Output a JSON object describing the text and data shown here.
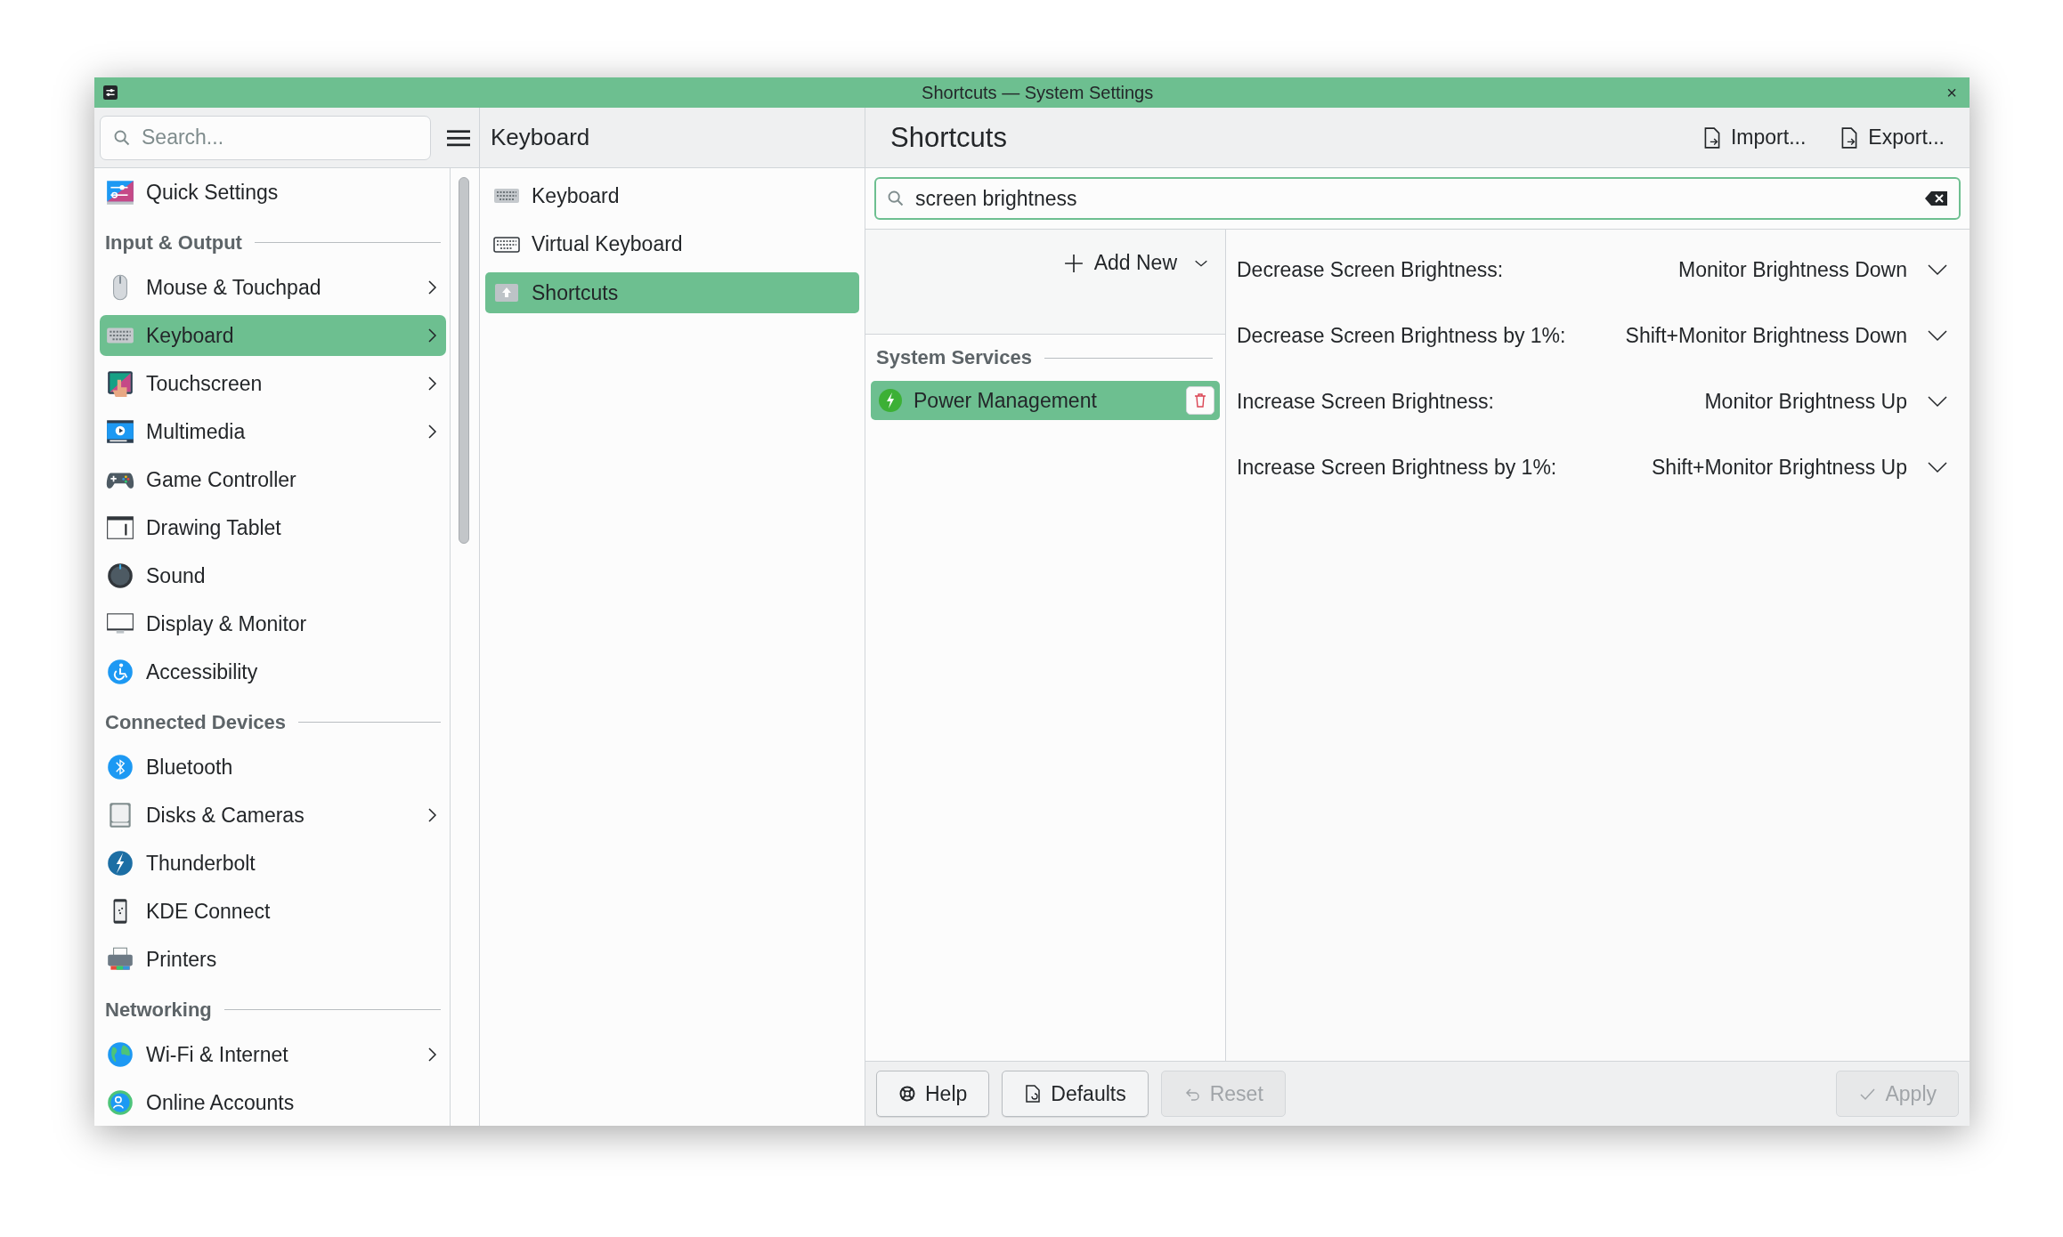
{
  "window": {
    "title": "Shortcuts — System Settings",
    "close_glyph": "×"
  },
  "sidebar": {
    "search": {
      "placeholder": "Search..."
    },
    "items": [
      {
        "kind": "item",
        "label": "Quick Settings",
        "has_submenu": false,
        "selected": false
      },
      {
        "kind": "header",
        "label": "Input & Output"
      },
      {
        "kind": "item",
        "label": "Mouse & Touchpad",
        "has_submenu": true,
        "selected": false
      },
      {
        "kind": "item",
        "label": "Keyboard",
        "has_submenu": true,
        "selected": true
      },
      {
        "kind": "item",
        "label": "Touchscreen",
        "has_submenu": true,
        "selected": false
      },
      {
        "kind": "item",
        "label": "Multimedia",
        "has_submenu": true,
        "selected": false
      },
      {
        "kind": "item",
        "label": "Game Controller",
        "has_submenu": false,
        "selected": false
      },
      {
        "kind": "item",
        "label": "Drawing Tablet",
        "has_submenu": false,
        "selected": false
      },
      {
        "kind": "item",
        "label": "Sound",
        "has_submenu": false,
        "selected": false
      },
      {
        "kind": "item",
        "label": "Display & Monitor",
        "has_submenu": false,
        "selected": false
      },
      {
        "kind": "item",
        "label": "Accessibility",
        "has_submenu": false,
        "selected": false
      },
      {
        "kind": "header",
        "label": "Connected Devices"
      },
      {
        "kind": "item",
        "label": "Bluetooth",
        "has_submenu": false,
        "selected": false
      },
      {
        "kind": "item",
        "label": "Disks & Cameras",
        "has_submenu": true,
        "selected": false
      },
      {
        "kind": "item",
        "label": "Thunderbolt",
        "has_submenu": false,
        "selected": false
      },
      {
        "kind": "item",
        "label": "KDE Connect",
        "has_submenu": false,
        "selected": false
      },
      {
        "kind": "item",
        "label": "Printers",
        "has_submenu": false,
        "selected": false
      },
      {
        "kind": "header",
        "label": "Networking"
      },
      {
        "kind": "item",
        "label": "Wi-Fi & Internet",
        "has_submenu": true,
        "selected": false
      },
      {
        "kind": "item",
        "label": "Online Accounts",
        "has_submenu": false,
        "selected": false
      }
    ]
  },
  "subpage": {
    "title": "Keyboard",
    "items": [
      {
        "label": "Keyboard",
        "selected": false
      },
      {
        "label": "Virtual Keyboard",
        "selected": false
      },
      {
        "label": "Shortcuts",
        "selected": true
      }
    ]
  },
  "content": {
    "title": "Shortcuts",
    "actions": [
      "Import...",
      "Export..."
    ],
    "filter": {
      "value": "screen brightness"
    },
    "add_new": "Add New",
    "group": "System Services",
    "components": [
      {
        "label": "Power Management",
        "selected": true
      }
    ],
    "shortcuts": [
      {
        "action": "Decrease Screen Brightness:",
        "key": "Monitor Brightness Down"
      },
      {
        "action": "Decrease Screen Brightness by 1%:",
        "key": "Shift+Monitor Brightness Down"
      },
      {
        "action": "Increase Screen Brightness:",
        "key": "Monitor Brightness Up"
      },
      {
        "action": "Increase Screen Brightness by 1%:",
        "key": "Shift+Monitor Brightness Up"
      }
    ]
  },
  "footer": {
    "buttons": [
      {
        "kind": "help",
        "label": "Help",
        "disabled": false
      },
      {
        "kind": "defaults",
        "label": "Defaults",
        "disabled": false
      },
      {
        "kind": "reset",
        "label": "Reset",
        "disabled": true
      }
    ],
    "apply": {
      "label": "Apply",
      "disabled": true
    }
  }
}
